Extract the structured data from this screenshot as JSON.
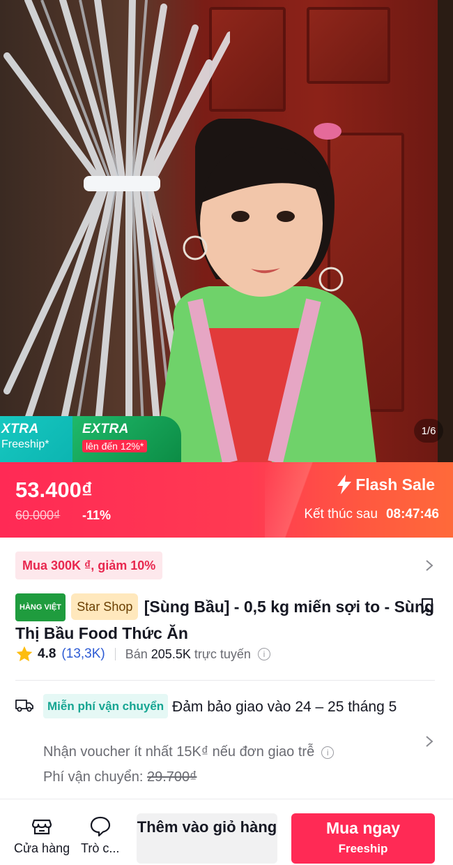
{
  "hero": {
    "image_counter": "1/6",
    "promo_xtra_title": "XTRA",
    "promo_xtra_sub": "Freeship*",
    "promo_extra_title": "EXTRA",
    "promo_extra_sub": "lên đến 12%*"
  },
  "price_bar": {
    "price": "53.400₫",
    "old_price": "60.000₫",
    "discount": "-11%",
    "flash_sale_label": "Flash Sale",
    "ends_label": "Kết thúc sau",
    "countdown": "08:47:46"
  },
  "voucher": {
    "label": "Mua 300K ₫, giảm 10%"
  },
  "product": {
    "badge_origin": "HÀNG VIỆT",
    "shop_name": "Star Shop",
    "title": "[Sùng Bầu] - 0,5 kg miến sợi to - Sùng Thị Bầu Food Thức Ăn",
    "rating": "4.8",
    "review_count": "(13,3K)",
    "sold_prefix": "Bán",
    "sold_value": "205.5K",
    "sold_suffix": "trực tuyến"
  },
  "shipping": {
    "free_tag": "Miễn phí vận chuyển",
    "delivery_text": "Đảm bảo giao vào 24 – 25 tháng 5",
    "voucher_note": "Nhận voucher ít nhất 15K₫ nếu đơn giao trễ",
    "fee_label": "Phí vận chuyển:",
    "fee_old": "29.700₫"
  },
  "bottom_bar": {
    "shop_label": "Cửa hàng",
    "chat_label": "Trò c...",
    "add_to_cart": "Thêm vào giỏ hàng",
    "buy_now": "Mua ngay",
    "buy_now_sub": "Freeship"
  },
  "colors": {
    "accent": "#ff2a55",
    "flash_gradient_end": "#ff6a3a",
    "freeship_teal": "#16a592",
    "link_blue": "#2d5bd4",
    "star_yellow": "#fdbd10"
  }
}
